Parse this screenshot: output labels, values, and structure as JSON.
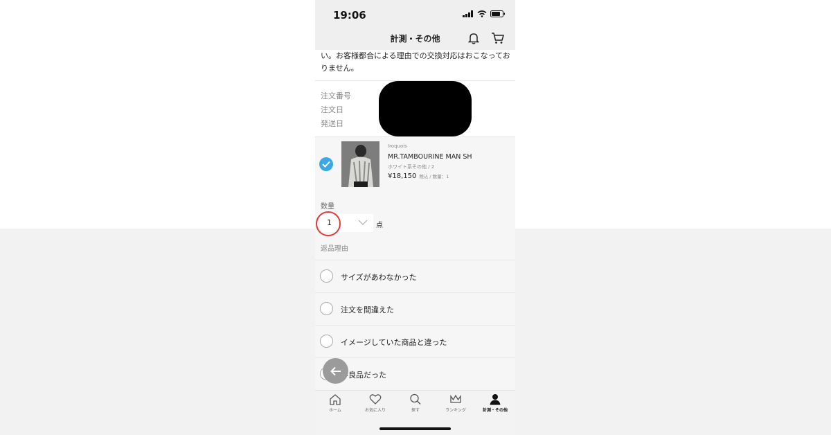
{
  "status_bar": {
    "time": "19:06"
  },
  "nav": {
    "title": "計測・その他"
  },
  "notice": {
    "text": "い。お客様都合による理由での交換対応はおこなっておりません。"
  },
  "order_info": {
    "labels": [
      "注文番号",
      "注文日",
      "発送日"
    ]
  },
  "product": {
    "brand": "Iroquois",
    "name": "MR.TAMBOURINE MAN SH",
    "variant": "ホワイト系その他 / 2",
    "price": "¥18,150",
    "price_note": "税込 / 数量：1",
    "checked": true
  },
  "quantity": {
    "label": "数量",
    "value": "1",
    "unit": "点"
  },
  "return_reason": {
    "label": "返品理由",
    "options": [
      "サイズがあわなかった",
      "注文を間違えた",
      "イメージしていた商品と違った",
      "不良品だった"
    ]
  },
  "tabbar": {
    "items": [
      {
        "label": "ホーム",
        "icon": "home-icon"
      },
      {
        "label": "お気に入り",
        "icon": "heart-icon"
      },
      {
        "label": "探す",
        "icon": "search-icon"
      },
      {
        "label": "ランキング",
        "icon": "crown-icon"
      },
      {
        "label": "計測・その他",
        "icon": "person-icon",
        "active": true
      }
    ]
  },
  "colors": {
    "accent_check": "#3aa8e4",
    "annotation_red": "#e03a3a"
  }
}
